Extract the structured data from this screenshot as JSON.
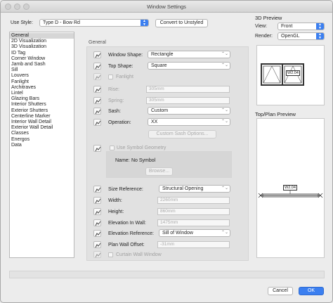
{
  "window": {
    "title": "Window Settings"
  },
  "style": {
    "label": "Use Style:",
    "value": "Type D - Bow Rd",
    "convert_button": "Convert to Unstyled"
  },
  "categories": [
    "General",
    "2D Visualization",
    "3D Visualization",
    "ID Tag",
    "Corner Window",
    "Jamb and Sash",
    "Sill",
    "Louvers",
    "Fanlight",
    "Architraves",
    "Lintel",
    "Glazing Bars",
    "Interior Shutters",
    "Exterior Shutters",
    "Centerline Marker",
    "Interior Wall Detail",
    "Exterior Wall Detail",
    "Classes",
    "Energos",
    "Data"
  ],
  "selected_category": "General",
  "general": {
    "section_title": "General",
    "window_shape": {
      "label": "Window Shape:",
      "value": "Rectangle"
    },
    "top_shape": {
      "label": "Top Shape:",
      "value": "Square"
    },
    "fanlight": {
      "label": "Fanlight"
    },
    "rise": {
      "label": "Rise:",
      "value": "305mm"
    },
    "spring": {
      "label": "Spring:",
      "value": "305mm"
    },
    "sash": {
      "label": "Sash:",
      "value": "Custom"
    },
    "operation": {
      "label": "Operation:",
      "value": "XX"
    },
    "custom_sash_button": "Custom Sash Options...",
    "use_symbol": {
      "label": "Use Symbol Geometry"
    },
    "symbol_name": {
      "label": "Name:",
      "value": "No Symbol"
    },
    "browse_button": "Browse...",
    "size_reference": {
      "label": "Size Reference:",
      "value": "Structural Opening"
    },
    "width": {
      "label": "Width:",
      "value": "2260mm"
    },
    "height": {
      "label": "Height:",
      "value": "860mm"
    },
    "elevation_in_wall": {
      "label": "Elevation In Wall:",
      "value": "1475mm"
    },
    "elevation_reference": {
      "label": "Elevation Reference:",
      "value": "Sill of Window"
    },
    "plan_wall_offset": {
      "label": "Plan Wall Offset:",
      "value": "-31mm"
    },
    "curtain_wall": {
      "label": "Curtain Wall Window"
    }
  },
  "preview3d": {
    "title": "3D Preview",
    "view_label": "View:",
    "view_value": "Front",
    "render_label": "Render:",
    "render_value": "OpenGL",
    "tag": "W2.04"
  },
  "plan_preview": {
    "title": "Top/Plan Preview",
    "tag": "W2.04"
  },
  "footer": {
    "cancel": "Cancel",
    "ok": "OK"
  },
  "colors": {
    "accent": "#3b7ff0"
  }
}
